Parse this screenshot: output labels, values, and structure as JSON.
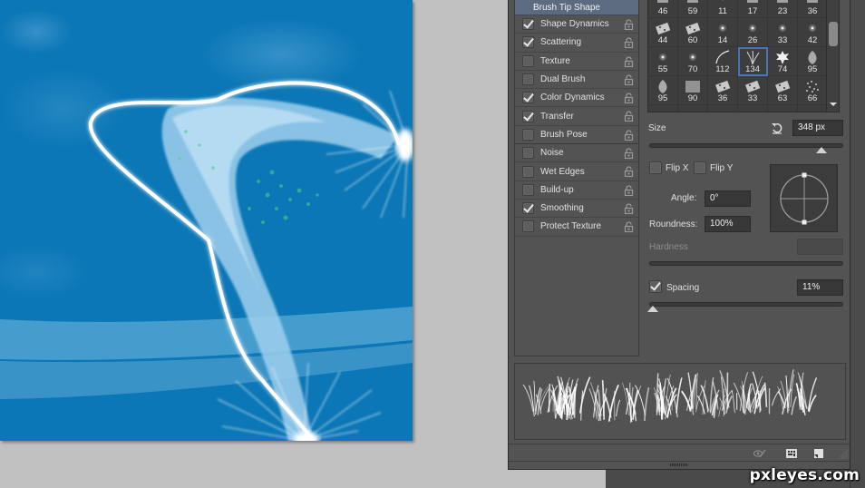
{
  "brush_panel": {
    "options": [
      {
        "label": "Brush Tip Shape",
        "checked": null,
        "header": true
      },
      {
        "label": "Shape Dynamics",
        "checked": true
      },
      {
        "label": "Scattering",
        "checked": true
      },
      {
        "label": "Texture",
        "checked": false
      },
      {
        "label": "Dual Brush",
        "checked": false
      },
      {
        "label": "Color Dynamics",
        "checked": true
      },
      {
        "label": "Transfer",
        "checked": true
      },
      {
        "label": "Brush Pose",
        "checked": false
      },
      {
        "label": "Noise",
        "checked": false
      },
      {
        "label": "Wet Edges",
        "checked": false
      },
      {
        "label": "Build-up",
        "checked": false
      },
      {
        "label": "Smoothing",
        "checked": true
      },
      {
        "label": "Protect Texture",
        "checked": false
      }
    ],
    "tips": [
      {
        "size": "46",
        "kind": "textured"
      },
      {
        "size": "59",
        "kind": "textured"
      },
      {
        "size": "11",
        "kind": "dot"
      },
      {
        "size": "17",
        "kind": "textured"
      },
      {
        "size": "23",
        "kind": "textured"
      },
      {
        "size": "36",
        "kind": "textured"
      },
      {
        "size": "44",
        "kind": "chunk"
      },
      {
        "size": "60",
        "kind": "chunk"
      },
      {
        "size": "14",
        "kind": "star"
      },
      {
        "size": "26",
        "kind": "star"
      },
      {
        "size": "33",
        "kind": "star"
      },
      {
        "size": "42",
        "kind": "star"
      },
      {
        "size": "55",
        "kind": "star"
      },
      {
        "size": "70",
        "kind": "star"
      },
      {
        "size": "112",
        "kind": "arc"
      },
      {
        "size": "134",
        "kind": "grass",
        "selected": true
      },
      {
        "size": "74",
        "kind": "leaf-maple"
      },
      {
        "size": "95",
        "kind": "leaf"
      },
      {
        "size": "95",
        "kind": "leaf"
      },
      {
        "size": "90",
        "kind": "noise"
      },
      {
        "size": "36",
        "kind": "chunk"
      },
      {
        "size": "33",
        "kind": "chunk"
      },
      {
        "size": "63",
        "kind": "chunk"
      },
      {
        "size": "66",
        "kind": "spray"
      }
    ],
    "size_label": "Size",
    "size_value": "348 px",
    "size_slider_fraction": 0.89,
    "flip_x_label": "Flip X",
    "flip_x_checked": false,
    "flip_y_label": "Flip Y",
    "flip_y_checked": false,
    "angle_label": "Angle:",
    "angle_value": "0°",
    "roundness_label": "Roundness:",
    "roundness_value": "100%",
    "hardness_label": "Hardness",
    "hardness_value": "",
    "spacing_label": "Spacing",
    "spacing_checked": true,
    "spacing_value": "11%",
    "spacing_slider_fraction": 0.02
  },
  "footer_icons": [
    "toggle-live-tip-icon",
    "brush-grid-icon",
    "new-preset-icon"
  ],
  "watermark": "pxleyes.com",
  "colors": {
    "canvas_blue": "#0a78b8",
    "panel_bg": "#535353",
    "selected_header": "#5c6b80",
    "selection_outline": "#4a74b8"
  }
}
